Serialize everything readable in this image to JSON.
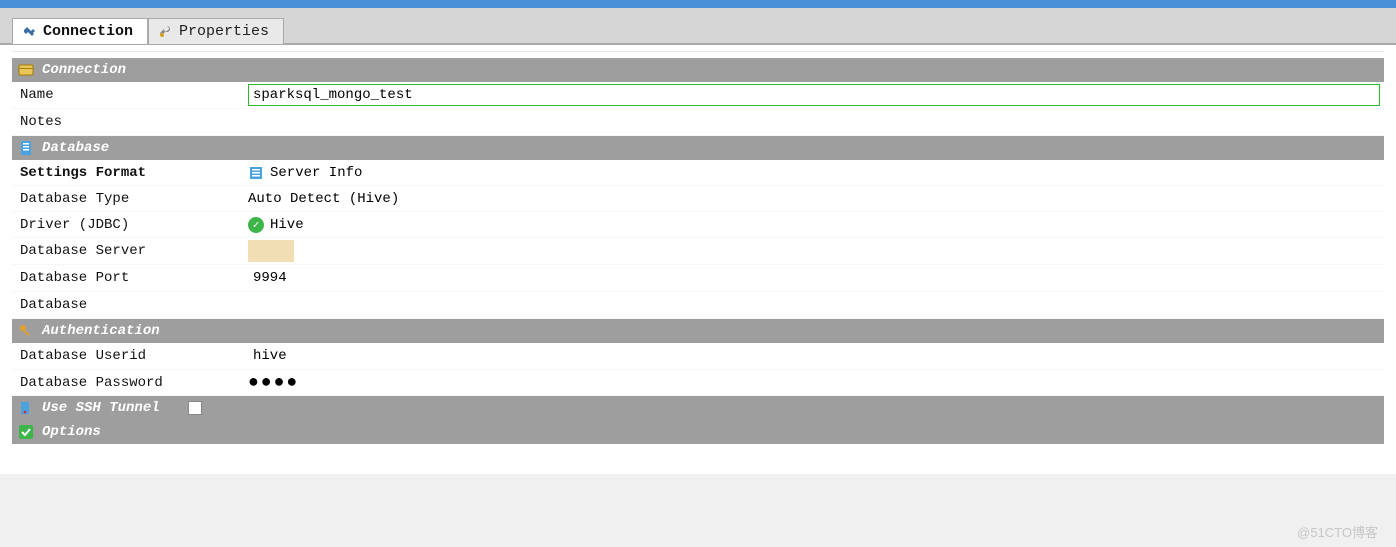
{
  "tabs": {
    "connection": "Connection",
    "properties": "Properties"
  },
  "sections": {
    "connection": "Connection",
    "database": "Database",
    "authentication": "Authentication",
    "ssh": "Use SSH Tunnel",
    "options": "Options"
  },
  "fields": {
    "name_label": "Name",
    "name_value": "sparksql_mongo_test",
    "notes_label": "Notes",
    "notes_value": "",
    "settings_format_label": "Settings Format",
    "settings_format_value": "Server Info",
    "database_type_label": "Database Type",
    "database_type_value": "Auto Detect (Hive)",
    "driver_label": "Driver (JDBC)",
    "driver_value": "Hive",
    "server_label": "Database Server",
    "server_value": "",
    "port_label": "Database Port",
    "port_value": "9994",
    "database_label": "Database",
    "database_value": "",
    "userid_label": "Database Userid",
    "userid_value": "hive",
    "password_label": "Database Password",
    "password_value": "●●●●"
  },
  "ssh_checked": false,
  "watermark": "@51CTO博客"
}
